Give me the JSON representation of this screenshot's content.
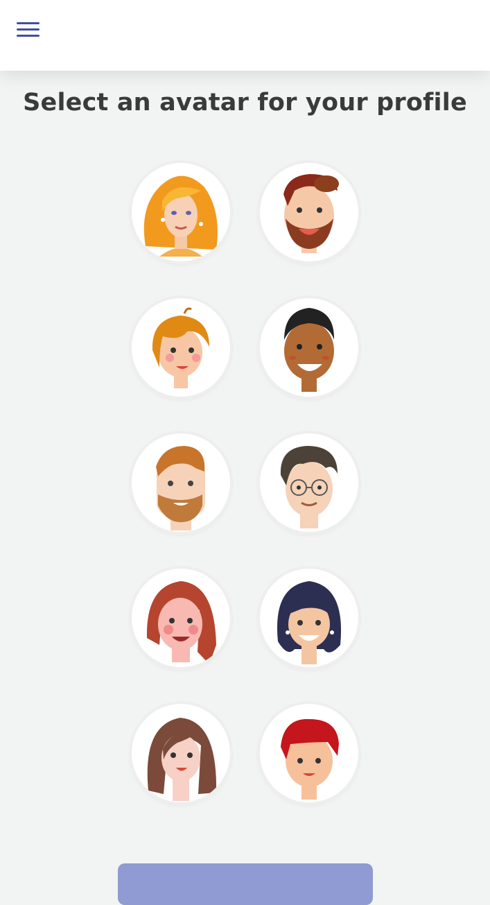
{
  "header": {
    "menu_icon": "hamburger-menu-icon"
  },
  "title": "Select an avatar for your profile",
  "avatars": [
    {
      "label": "avatar-1",
      "hair": "#f5a623",
      "skin": "#f8d0b5",
      "style": "long-hair-woman"
    },
    {
      "label": "avatar-2",
      "hair": "#8b2a1a",
      "skin": "#f5c9a8",
      "style": "bearded-man"
    },
    {
      "label": "avatar-3",
      "hair": "#e08a14",
      "skin": "#f7c7a5",
      "style": "short-hair-kid"
    },
    {
      "label": "avatar-4",
      "hair": "#222222",
      "skin": "#b36b35",
      "style": "dark-skin-man"
    },
    {
      "label": "avatar-5",
      "hair": "#c8742a",
      "skin": "#f6d2b8",
      "style": "ginger-beard-man"
    },
    {
      "label": "avatar-6",
      "hair": "#4c4237",
      "skin": "#f6d2b8",
      "style": "glasses-man"
    },
    {
      "label": "avatar-7",
      "hair": "#b5452f",
      "skin": "#f7b9b1",
      "style": "red-hair-woman"
    },
    {
      "label": "avatar-8",
      "hair": "#2d2f52",
      "skin": "#f3c6a1",
      "style": "bob-hair-woman"
    },
    {
      "label": "avatar-9",
      "hair": "#7b4a3a",
      "skin": "#f7d1c6",
      "style": "brown-hair-woman"
    },
    {
      "label": "avatar-10",
      "hair": "#c4161c",
      "skin": "#f6c09b",
      "style": "red-hair-man"
    }
  ],
  "confirm_button": {
    "label": ""
  }
}
